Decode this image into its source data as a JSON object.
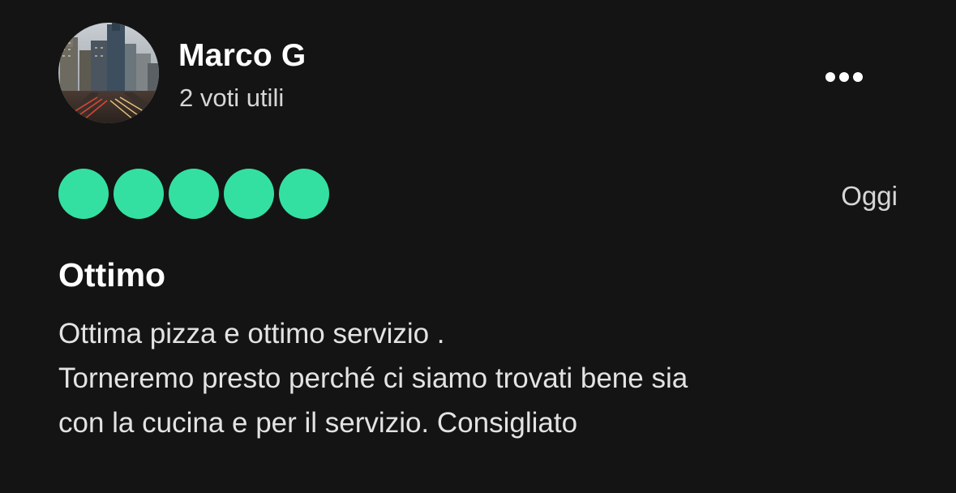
{
  "review": {
    "user": {
      "name": "Marco G",
      "helpful_votes": "2 voti utili",
      "avatar_icon": "city-skyline-photo"
    },
    "more_icon": "more-options-icon",
    "rating": {
      "value": 5,
      "max": 5,
      "color": "#34e0a1"
    },
    "date": "Oggi",
    "title": "Ottimo",
    "body_lines": [
      "Ottima pizza e ottimo servizio .",
      "Torneremo presto perché ci siamo trovati bene sia",
      "con la cucina e per il servizio. Consigliato"
    ]
  },
  "theme": {
    "background": "#141414",
    "text_primary": "#ffffff",
    "text_secondary": "#d6d6d6",
    "accent": "#34e0a1"
  }
}
